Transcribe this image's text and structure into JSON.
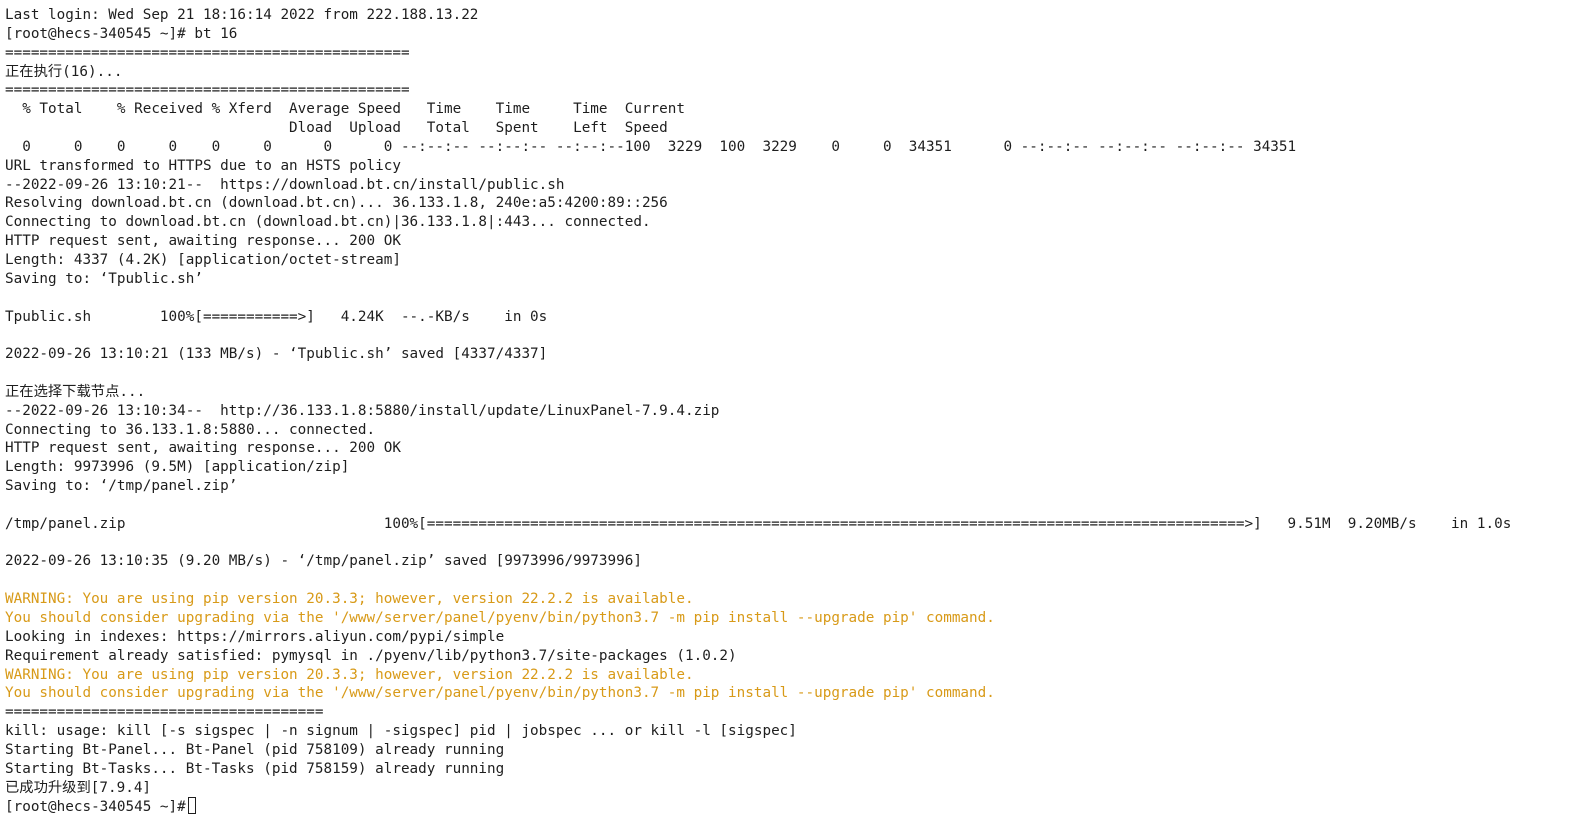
{
  "colors": {
    "background": "#ffffff",
    "text": "#1e1e1e",
    "warning": "#d89a18"
  },
  "terminal": {
    "lines": [
      {
        "text": "Last login: Wed Sep 21 18:16:14 2022 from 222.188.13.22",
        "style": "normal"
      },
      {
        "text": "[root@hecs-340545 ~]# bt 16",
        "style": "normal"
      },
      {
        "text": "===============================================",
        "style": "normal"
      },
      {
        "text": "正在执行(16)...",
        "style": "normal"
      },
      {
        "text": "===============================================",
        "style": "normal"
      },
      {
        "text": "  % Total    % Received % Xferd  Average Speed   Time    Time     Time  Current",
        "style": "normal"
      },
      {
        "text": "                                 Dload  Upload   Total   Spent    Left  Speed",
        "style": "normal"
      },
      {
        "text": "  0     0    0     0    0     0      0      0 --:--:-- --:--:-- --:--:--100  3229  100  3229    0     0  34351      0 --:--:-- --:--:-- --:--:-- 34351",
        "style": "normal"
      },
      {
        "text": "URL transformed to HTTPS due to an HSTS policy",
        "style": "normal"
      },
      {
        "text": "--2022-09-26 13:10:21--  https://download.bt.cn/install/public.sh",
        "style": "normal"
      },
      {
        "text": "Resolving download.bt.cn (download.bt.cn)... 36.133.1.8, 240e:a5:4200:89::256",
        "style": "normal"
      },
      {
        "text": "Connecting to download.bt.cn (download.bt.cn)|36.133.1.8|:443... connected.",
        "style": "normal"
      },
      {
        "text": "HTTP request sent, awaiting response... 200 OK",
        "style": "normal"
      },
      {
        "text": "Length: 4337 (4.2K) [application/octet-stream]",
        "style": "normal"
      },
      {
        "text": "Saving to: ‘Tpublic.sh’",
        "style": "normal"
      },
      {
        "text": "",
        "style": "normal"
      },
      {
        "text": "Tpublic.sh        100%[===========>]   4.24K  --.-KB/s    in 0s",
        "style": "normal"
      },
      {
        "text": "",
        "style": "normal"
      },
      {
        "text": "2022-09-26 13:10:21 (133 MB/s) - ‘Tpublic.sh’ saved [4337/4337]",
        "style": "normal"
      },
      {
        "text": "",
        "style": "normal"
      },
      {
        "text": "正在选择下载节点...",
        "style": "normal"
      },
      {
        "text": "--2022-09-26 13:10:34--  http://36.133.1.8:5880/install/update/LinuxPanel-7.9.4.zip",
        "style": "normal"
      },
      {
        "text": "Connecting to 36.133.1.8:5880... connected.",
        "style": "normal"
      },
      {
        "text": "HTTP request sent, awaiting response... 200 OK",
        "style": "normal"
      },
      {
        "text": "Length: 9973996 (9.5M) [application/zip]",
        "style": "normal"
      },
      {
        "text": "Saving to: ‘/tmp/panel.zip’",
        "style": "normal"
      },
      {
        "text": "",
        "style": "normal"
      },
      {
        "text": "/tmp/panel.zip                              100%[===============================================================================================>]   9.51M  9.20MB/s    in 1.0s",
        "style": "normal"
      },
      {
        "text": "",
        "style": "normal"
      },
      {
        "text": "2022-09-26 13:10:35 (9.20 MB/s) - ‘/tmp/panel.zip’ saved [9973996/9973996]",
        "style": "normal"
      },
      {
        "text": "",
        "style": "normal"
      },
      {
        "text": "WARNING: You are using pip version 20.3.3; however, version 22.2.2 is available.",
        "style": "warning"
      },
      {
        "text": "You should consider upgrading via the '/www/server/panel/pyenv/bin/python3.7 -m pip install --upgrade pip' command.",
        "style": "warning"
      },
      {
        "text": "Looking in indexes: https://mirrors.aliyun.com/pypi/simple",
        "style": "normal"
      },
      {
        "text": "Requirement already satisfied: pymysql in ./pyenv/lib/python3.7/site-packages (1.0.2)",
        "style": "normal"
      },
      {
        "text": "WARNING: You are using pip version 20.3.3; however, version 22.2.2 is available.",
        "style": "warning"
      },
      {
        "text": "You should consider upgrading via the '/www/server/panel/pyenv/bin/python3.7 -m pip install --upgrade pip' command.",
        "style": "warning"
      },
      {
        "text": "=====================================",
        "style": "normal"
      },
      {
        "text": "kill: usage: kill [-s sigspec | -n signum | -sigspec] pid | jobspec ... or kill -l [sigspec]",
        "style": "normal"
      },
      {
        "text": "Starting Bt-Panel... Bt-Panel (pid 758109) already running",
        "style": "normal"
      },
      {
        "text": "Starting Bt-Tasks... Bt-Tasks (pid 758159) already running",
        "style": "normal"
      },
      {
        "text": "已成功升级到[7.9.4]",
        "style": "normal"
      }
    ],
    "prompt": "[root@hecs-340545 ~]#"
  }
}
